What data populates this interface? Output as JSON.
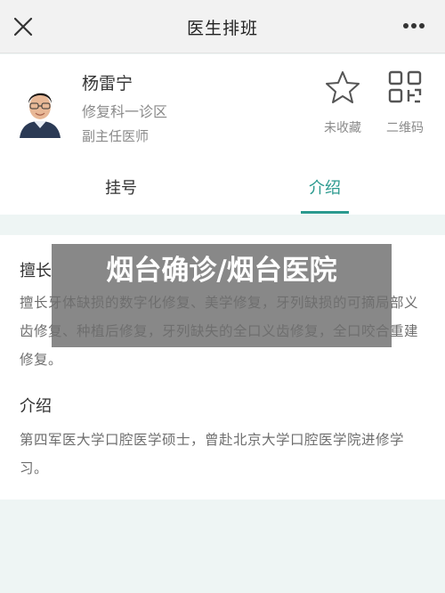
{
  "nav": {
    "title": "医生排班"
  },
  "doctor": {
    "name": "杨雷宁",
    "department": "修复科一诊区",
    "title": "副主任医师"
  },
  "actions": {
    "favorite_label": "未收藏",
    "qrcode_label": "二维码"
  },
  "tabs": [
    {
      "label": "挂号",
      "active": false
    },
    {
      "label": "介绍",
      "active": true
    }
  ],
  "sections": {
    "specialty_heading": "擅长",
    "specialty_text": "擅长牙体缺损的数字化修复、美学修复，牙列缺损的可摘局部义齿修复、种植后修复，牙列缺失的全口义齿修复，全口咬合重建修复。",
    "intro_heading": "介绍",
    "intro_text": "第四军医大学口腔医学硕士，曾赴北京大学口腔医学院进修学习。"
  },
  "watermark": "烟台确诊/烟台医院",
  "colors": {
    "accent": "#2b9a8f",
    "page_bg": "#eef5f4"
  }
}
